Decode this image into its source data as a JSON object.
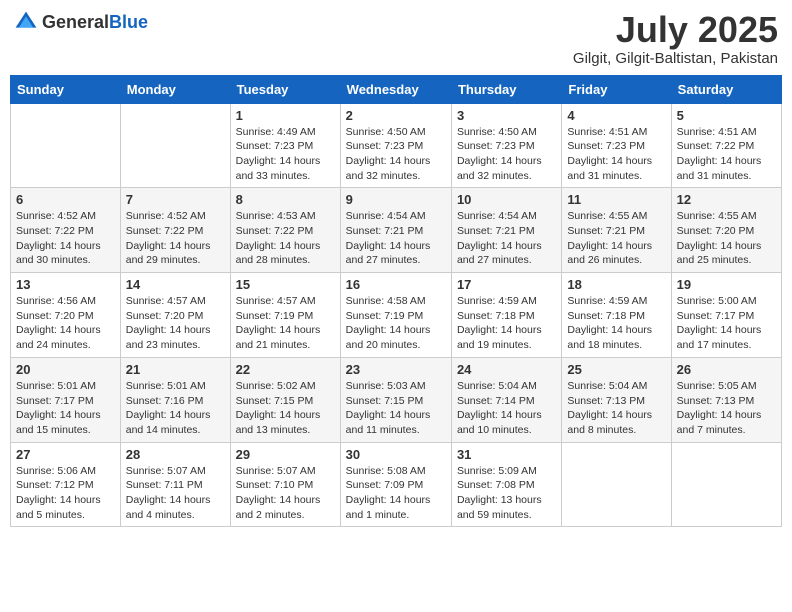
{
  "header": {
    "logo_general": "General",
    "logo_blue": "Blue",
    "month": "July 2025",
    "location": "Gilgit, Gilgit-Baltistan, Pakistan"
  },
  "days_of_week": [
    "Sunday",
    "Monday",
    "Tuesday",
    "Wednesday",
    "Thursday",
    "Friday",
    "Saturday"
  ],
  "weeks": [
    [
      {
        "day": "",
        "info": ""
      },
      {
        "day": "",
        "info": ""
      },
      {
        "day": "1",
        "info": "Sunrise: 4:49 AM\nSunset: 7:23 PM\nDaylight: 14 hours and 33 minutes."
      },
      {
        "day": "2",
        "info": "Sunrise: 4:50 AM\nSunset: 7:23 PM\nDaylight: 14 hours and 32 minutes."
      },
      {
        "day": "3",
        "info": "Sunrise: 4:50 AM\nSunset: 7:23 PM\nDaylight: 14 hours and 32 minutes."
      },
      {
        "day": "4",
        "info": "Sunrise: 4:51 AM\nSunset: 7:23 PM\nDaylight: 14 hours and 31 minutes."
      },
      {
        "day": "5",
        "info": "Sunrise: 4:51 AM\nSunset: 7:22 PM\nDaylight: 14 hours and 31 minutes."
      }
    ],
    [
      {
        "day": "6",
        "info": "Sunrise: 4:52 AM\nSunset: 7:22 PM\nDaylight: 14 hours and 30 minutes."
      },
      {
        "day": "7",
        "info": "Sunrise: 4:52 AM\nSunset: 7:22 PM\nDaylight: 14 hours and 29 minutes."
      },
      {
        "day": "8",
        "info": "Sunrise: 4:53 AM\nSunset: 7:22 PM\nDaylight: 14 hours and 28 minutes."
      },
      {
        "day": "9",
        "info": "Sunrise: 4:54 AM\nSunset: 7:21 PM\nDaylight: 14 hours and 27 minutes."
      },
      {
        "day": "10",
        "info": "Sunrise: 4:54 AM\nSunset: 7:21 PM\nDaylight: 14 hours and 27 minutes."
      },
      {
        "day": "11",
        "info": "Sunrise: 4:55 AM\nSunset: 7:21 PM\nDaylight: 14 hours and 26 minutes."
      },
      {
        "day": "12",
        "info": "Sunrise: 4:55 AM\nSunset: 7:20 PM\nDaylight: 14 hours and 25 minutes."
      }
    ],
    [
      {
        "day": "13",
        "info": "Sunrise: 4:56 AM\nSunset: 7:20 PM\nDaylight: 14 hours and 24 minutes."
      },
      {
        "day": "14",
        "info": "Sunrise: 4:57 AM\nSunset: 7:20 PM\nDaylight: 14 hours and 23 minutes."
      },
      {
        "day": "15",
        "info": "Sunrise: 4:57 AM\nSunset: 7:19 PM\nDaylight: 14 hours and 21 minutes."
      },
      {
        "day": "16",
        "info": "Sunrise: 4:58 AM\nSunset: 7:19 PM\nDaylight: 14 hours and 20 minutes."
      },
      {
        "day": "17",
        "info": "Sunrise: 4:59 AM\nSunset: 7:18 PM\nDaylight: 14 hours and 19 minutes."
      },
      {
        "day": "18",
        "info": "Sunrise: 4:59 AM\nSunset: 7:18 PM\nDaylight: 14 hours and 18 minutes."
      },
      {
        "day": "19",
        "info": "Sunrise: 5:00 AM\nSunset: 7:17 PM\nDaylight: 14 hours and 17 minutes."
      }
    ],
    [
      {
        "day": "20",
        "info": "Sunrise: 5:01 AM\nSunset: 7:17 PM\nDaylight: 14 hours and 15 minutes."
      },
      {
        "day": "21",
        "info": "Sunrise: 5:01 AM\nSunset: 7:16 PM\nDaylight: 14 hours and 14 minutes."
      },
      {
        "day": "22",
        "info": "Sunrise: 5:02 AM\nSunset: 7:15 PM\nDaylight: 14 hours and 13 minutes."
      },
      {
        "day": "23",
        "info": "Sunrise: 5:03 AM\nSunset: 7:15 PM\nDaylight: 14 hours and 11 minutes."
      },
      {
        "day": "24",
        "info": "Sunrise: 5:04 AM\nSunset: 7:14 PM\nDaylight: 14 hours and 10 minutes."
      },
      {
        "day": "25",
        "info": "Sunrise: 5:04 AM\nSunset: 7:13 PM\nDaylight: 14 hours and 8 minutes."
      },
      {
        "day": "26",
        "info": "Sunrise: 5:05 AM\nSunset: 7:13 PM\nDaylight: 14 hours and 7 minutes."
      }
    ],
    [
      {
        "day": "27",
        "info": "Sunrise: 5:06 AM\nSunset: 7:12 PM\nDaylight: 14 hours and 5 minutes."
      },
      {
        "day": "28",
        "info": "Sunrise: 5:07 AM\nSunset: 7:11 PM\nDaylight: 14 hours and 4 minutes."
      },
      {
        "day": "29",
        "info": "Sunrise: 5:07 AM\nSunset: 7:10 PM\nDaylight: 14 hours and 2 minutes."
      },
      {
        "day": "30",
        "info": "Sunrise: 5:08 AM\nSunset: 7:09 PM\nDaylight: 14 hours and 1 minute."
      },
      {
        "day": "31",
        "info": "Sunrise: 5:09 AM\nSunset: 7:08 PM\nDaylight: 13 hours and 59 minutes."
      },
      {
        "day": "",
        "info": ""
      },
      {
        "day": "",
        "info": ""
      }
    ]
  ]
}
